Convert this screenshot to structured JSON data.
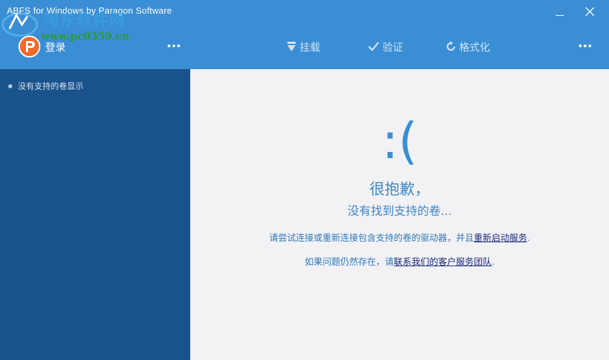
{
  "window": {
    "title": "ABFS for Windows by Paragon Software",
    "watermark_text": "河东软件网",
    "watermark_url": "www.pc0359.cn"
  },
  "toolbar": {
    "login_label": "登录",
    "mount_label": "挂载",
    "verify_label": "验证",
    "format_label": "格式化"
  },
  "sidebar": {
    "items": [
      {
        "label": "没有支持的卷显示"
      }
    ]
  },
  "main": {
    "emoticon": ":(",
    "sorry": "很抱歉，",
    "no_volume": "没有找到支持的卷...",
    "line1_prefix": "请尝试连接或重新连接包含支持的卷的驱动器，并且",
    "line1_link": "重新启动服务",
    "line1_suffix": ".",
    "line2_prefix": "如果问题仍然存在，请",
    "line2_link": "联系我们的客户服务团队",
    "line2_suffix": "."
  },
  "colors": {
    "titlebar": "#3a8ed4",
    "sidebar": "#1a528c",
    "content_bg": "#f2f1f4",
    "accent_text": "#3e88c5",
    "link": "#1a2a78"
  }
}
